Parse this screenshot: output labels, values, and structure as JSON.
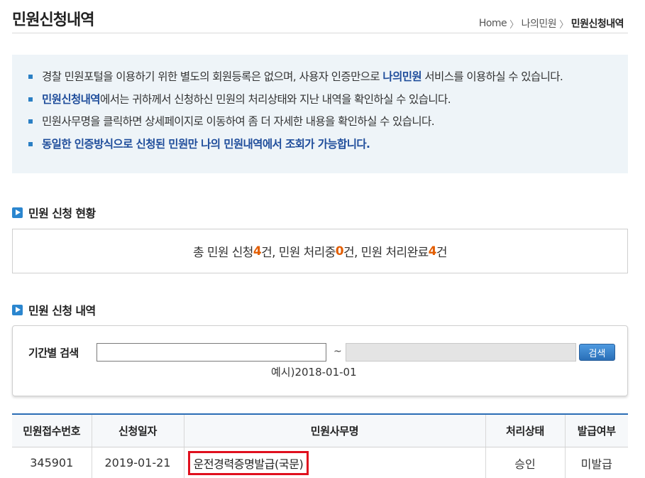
{
  "page": {
    "title": "민원신청내역"
  },
  "breadcrumb": {
    "home": "Home",
    "sep1": "〉",
    "level2": "나의민원",
    "sep2": "〉",
    "current": "민원신청내역"
  },
  "notice": {
    "line1_a": "경찰 민원포털을 이용하기 위한 별도의 회원등록은 없으며, 사용자 인증만으로 ",
    "line1_hl": "나의민원",
    "line1_b": " 서비스를 이용하실 수 있습니다.",
    "line2_hl": "민원신청내역",
    "line2_b": "에서는 귀하께서 신청하신 민원의 처리상태와 지난 내역을 확인하실 수 있습니다.",
    "line3": "민원사무명을 클릭하면 상세페이지로 이동하여 좀 더 자세한 내용을 확인하실 수 있습니다.",
    "line4": "동일한 인증방식으로 신청된 민원만 나의 민원내역에서 조회가 가능합니다."
  },
  "status_section": {
    "heading": "민원 신청 현황",
    "prefix": "총 민원 신청 ",
    "total": "4",
    "suffix1": "건, 민원 처리중 ",
    "in_progress": "0",
    "suffix2": "건, 민원 처리완료 ",
    "completed": "4",
    "suffix3": "건"
  },
  "history_section": {
    "heading": "민원 신청 내역"
  },
  "search": {
    "label": "기간별 검색",
    "start_value": "",
    "tilde": "~",
    "end_value": "",
    "button_label": "검색",
    "example": "예시)2018-01-01"
  },
  "table": {
    "headers": [
      "민원접수번호",
      "신청일자",
      "민원사무명",
      "처리상태",
      "발급여부"
    ],
    "rows": [
      {
        "receipt_no": "345901",
        "date": "2019-01-21",
        "name": "운전경력증명발급(국문)",
        "status": "승인",
        "issued": "미발급"
      }
    ]
  },
  "colors": {
    "accent_blue": "#2b86cf",
    "highlight_navy": "#1f4d9b",
    "count_orange": "#e35d00",
    "selection_red": "#e0101e"
  }
}
